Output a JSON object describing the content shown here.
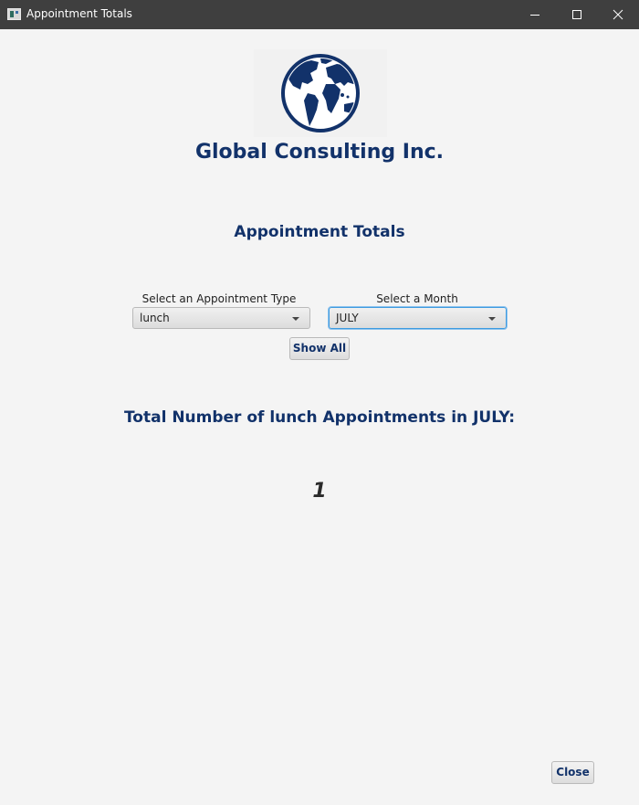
{
  "window": {
    "title": "Appointment Totals",
    "icon": "app-window-icon"
  },
  "header": {
    "logo_icon": "globe-icon",
    "company_name": "Global Consulting Inc.",
    "page_heading": "Appointment Totals"
  },
  "filters": {
    "type_label": "Select an Appointment Type",
    "type_value": "lunch",
    "month_label": "Select a Month",
    "month_value": "JULY",
    "show_all_label": "Show All"
  },
  "result": {
    "label": "Total Number of lunch Appointments in JULY:",
    "count": "1"
  },
  "footer": {
    "close_label": "Close"
  },
  "colors": {
    "brand": "#12326a",
    "titlebar": "#3f3f3f",
    "background": "#f4f4f4",
    "focus": "#3d9ae0"
  }
}
